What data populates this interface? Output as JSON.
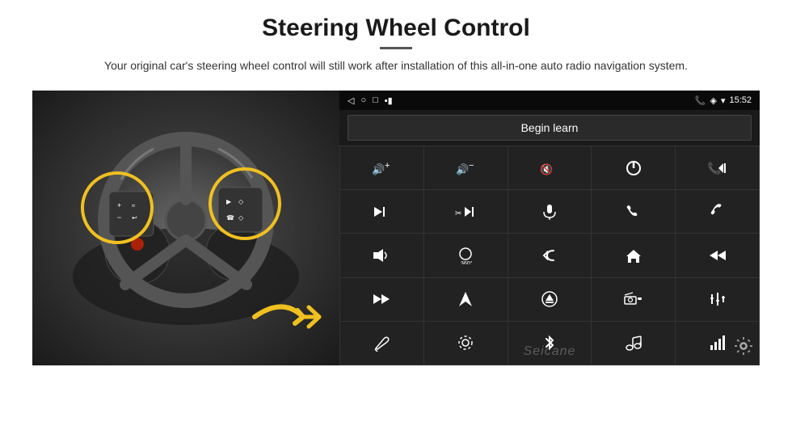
{
  "header": {
    "title": "Steering Wheel Control",
    "divider": true,
    "subtitle": "Your original car's steering wheel control will still work after installation of this all-in-one auto radio navigation system."
  },
  "android_ui": {
    "status_bar": {
      "back_icon": "◁",
      "home_icon": "○",
      "recent_icon": "□",
      "battery_icon": "▪▮",
      "phone_icon": "📞",
      "location_icon": "◈",
      "wifi_icon": "▾",
      "time": "15:52"
    },
    "begin_learn_label": "Begin learn",
    "controls": [
      {
        "icon": "🔊+",
        "label": "vol-up"
      },
      {
        "icon": "🔊−",
        "label": "vol-down"
      },
      {
        "icon": "🔇",
        "label": "mute"
      },
      {
        "icon": "⏻",
        "label": "power"
      },
      {
        "icon": "⏮",
        "label": "prev-track-phone"
      },
      {
        "icon": "⏭",
        "label": "next"
      },
      {
        "icon": "✂⏭",
        "label": "ff"
      },
      {
        "icon": "🎤",
        "label": "mic"
      },
      {
        "icon": "📞",
        "label": "call"
      },
      {
        "icon": "📵",
        "label": "hang-up"
      },
      {
        "icon": "📢",
        "label": "horn"
      },
      {
        "icon": "360°",
        "label": "360"
      },
      {
        "icon": "↩",
        "label": "back"
      },
      {
        "icon": "🏠",
        "label": "home"
      },
      {
        "icon": "⏮⏮",
        "label": "rew"
      },
      {
        "icon": "⏭⏭",
        "label": "fwd"
      },
      {
        "icon": "▶",
        "label": "nav"
      },
      {
        "icon": "⏺",
        "label": "eject"
      },
      {
        "icon": "📻",
        "label": "radio"
      },
      {
        "icon": "⚙",
        "label": "settings2"
      },
      {
        "icon": "✏",
        "label": "pen"
      },
      {
        "icon": "⊙",
        "label": "circle"
      },
      {
        "icon": "✱",
        "label": "bluetooth"
      },
      {
        "icon": "🎵",
        "label": "music"
      },
      {
        "icon": "📶",
        "label": "signal"
      }
    ],
    "watermark": "Seicane",
    "gear_icon": "⚙"
  }
}
